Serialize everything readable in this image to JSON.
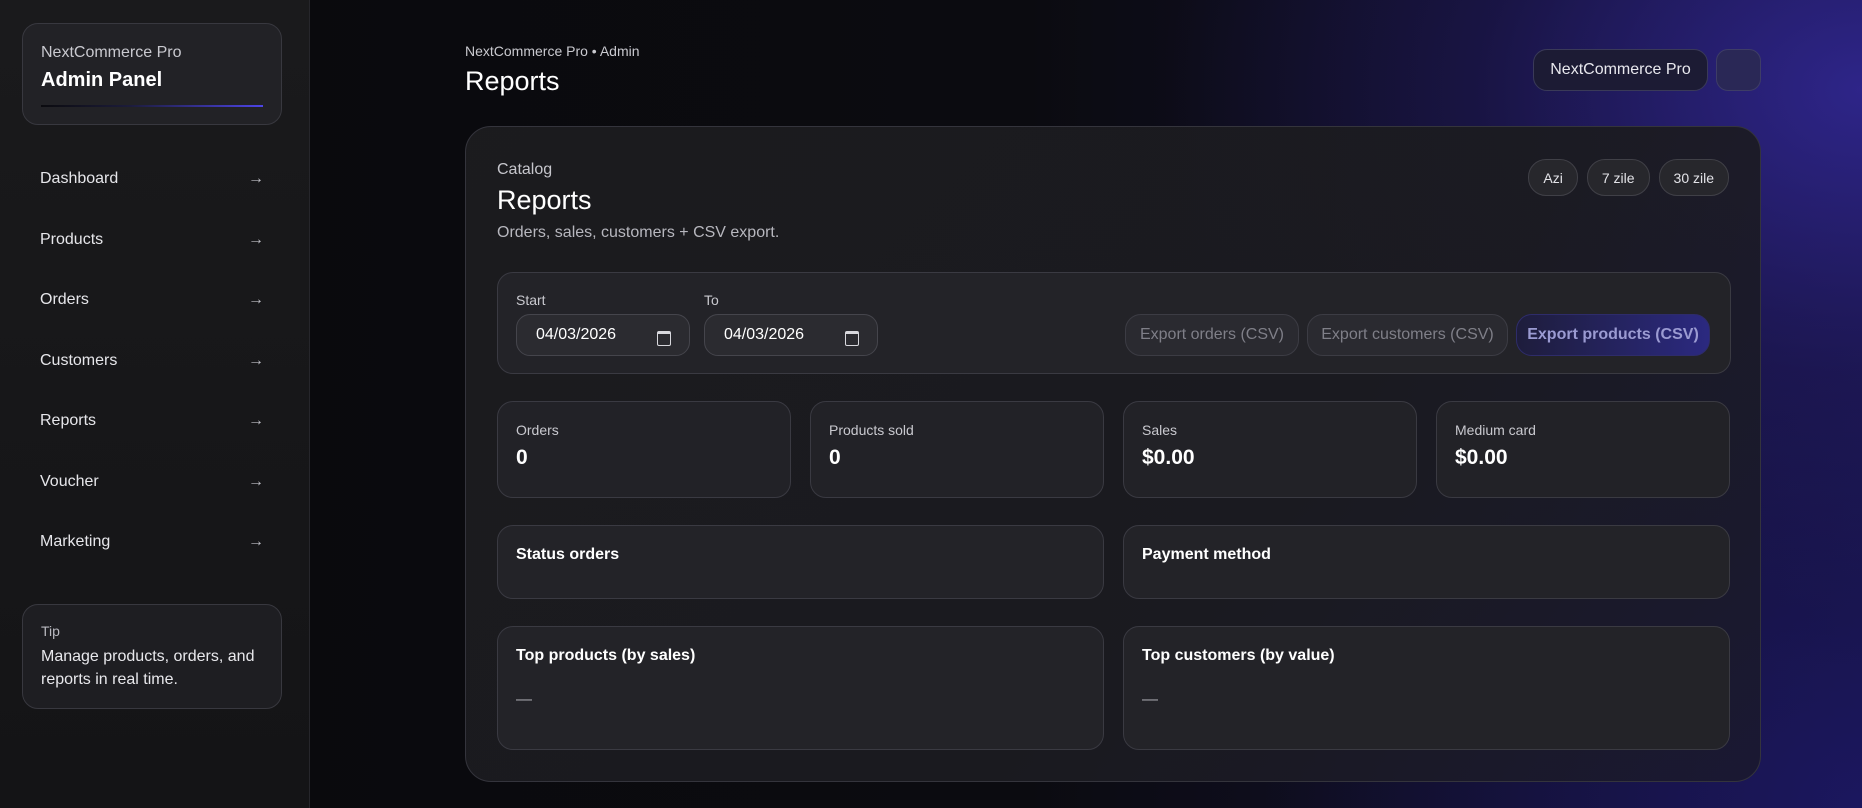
{
  "sidebar": {
    "brand_small": "NextCommerce Pro",
    "brand_title": "Admin Panel",
    "items": [
      {
        "label": "Dashboard",
        "arrow": "→"
      },
      {
        "label": "Products",
        "arrow": "→"
      },
      {
        "label": "Orders",
        "arrow": "→"
      },
      {
        "label": "Customers",
        "arrow": "→"
      },
      {
        "label": "Reports",
        "arrow": "→"
      },
      {
        "label": "Voucher",
        "arrow": "→"
      },
      {
        "label": "Marketing",
        "arrow": "→"
      }
    ],
    "tip_label": "Tip",
    "tip_text": "Manage products, orders, and reports in real time."
  },
  "header": {
    "breadcrumb": "NextCommerce Pro • Admin",
    "title": "Reports",
    "store_button": "NextCommerce Pro"
  },
  "panel": {
    "category": "Catalog",
    "title": "Reports",
    "description": "Orders, sales, customers + CSV export.",
    "ranges": [
      "Azi",
      "7 zile",
      "30 zile"
    ],
    "filters": {
      "start_label": "Start",
      "start_value": "04/03/2026",
      "end_label": "To",
      "end_value": "04/03/2026",
      "export_orders": "Export orders (CSV)",
      "export_customers": "Export customers (CSV)",
      "export_products": "Export products (CSV)"
    },
    "stats": [
      {
        "label": "Orders",
        "value": "0"
      },
      {
        "label": "Products sold",
        "value": "0"
      },
      {
        "label": "Sales",
        "value": "$0.00"
      },
      {
        "label": "Medium card",
        "value": "$0.00"
      }
    ],
    "status_orders_title": "Status orders",
    "payment_method_title": "Payment method",
    "top_products_title": "Top products (by sales)",
    "top_products_empty": "—",
    "top_customers_title": "Top customers (by value)",
    "top_customers_empty": "—"
  },
  "colors": {
    "accent": "#4c44e6",
    "background": "#0a0a0e"
  }
}
